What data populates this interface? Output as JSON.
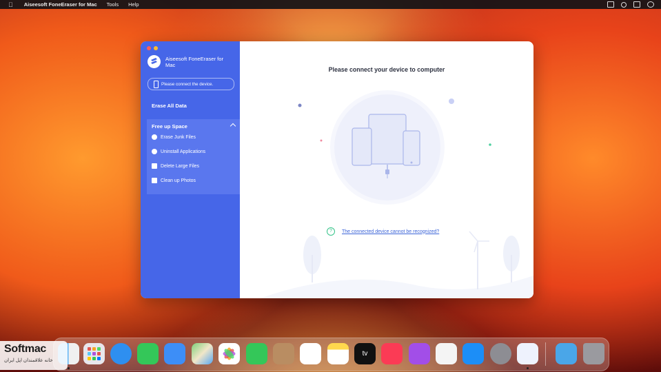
{
  "menubar": {
    "app": "Aiseesoft FoneEraser for Mac",
    "menus": [
      "Tools",
      "Help"
    ]
  },
  "sidebar": {
    "app_title": "Aiseesoft FoneEraser for Mac",
    "device_status": "Please connect the device.",
    "erase_all": "Erase All Data",
    "free_up": {
      "title": "Free up Space",
      "items": [
        "Erase Junk Files",
        "Uninstall Applications",
        "Delete Large Files",
        "Clean up Photos"
      ]
    }
  },
  "main": {
    "title": "Please connect your device to computer",
    "help_icon": "?",
    "help_link": "The connected device cannot be recognized?"
  },
  "dock": {
    "apps": [
      "finder",
      "launchpad",
      "safari",
      "messages",
      "mail",
      "maps",
      "photos",
      "facetime",
      "contacts",
      "reminders",
      "notes",
      "tv",
      "music",
      "podcasts",
      "news",
      "app-store",
      "system-preferences",
      "fone-eraser",
      "downloads",
      "trash"
    ],
    "tv_label": "tv"
  },
  "watermark": {
    "title": "Softmac",
    "subtitle": "خانه علاقمندان اپل ایران"
  },
  "colors": {
    "sidebar": "#4666e8",
    "panel": "#5a77ee",
    "link": "#3a63d8",
    "help": "#36c48a"
  }
}
